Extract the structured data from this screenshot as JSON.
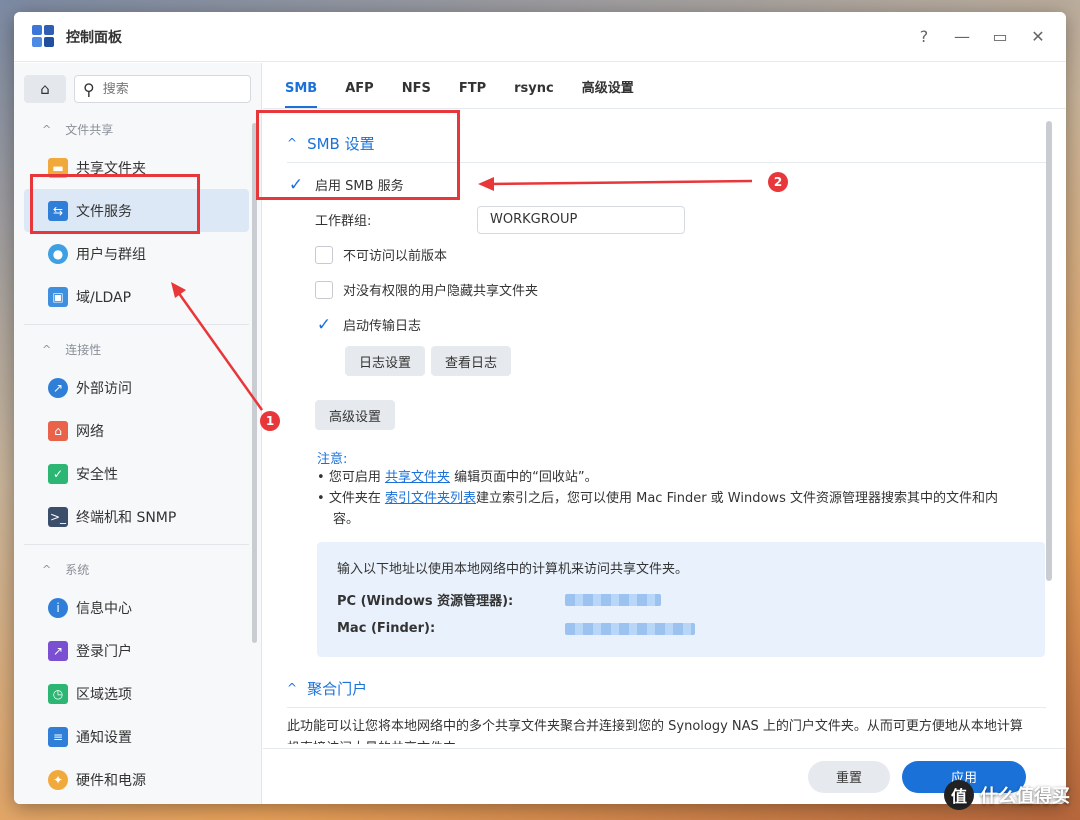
{
  "window": {
    "title": "控制面板",
    "controls": [
      "?",
      "—",
      "▭",
      "✕"
    ]
  },
  "sidebar": {
    "search_placeholder": "搜索",
    "groups": [
      {
        "title": "文件共享",
        "items": [
          {
            "label": "共享文件夹",
            "icon": "folder-icon",
            "color": "#f2a93b"
          },
          {
            "label": "文件服务",
            "icon": "file-services-icon",
            "color": "#2f7fd9",
            "active": true
          },
          {
            "label": "用户与群组",
            "icon": "users-icon",
            "color": "#3e9fe2"
          },
          {
            "label": "域/LDAP",
            "icon": "ldap-icon",
            "color": "#3e8fe0"
          }
        ]
      },
      {
        "title": "连接性",
        "items": [
          {
            "label": "外部访问",
            "icon": "external-access-icon",
            "color": "#2f7fd9"
          },
          {
            "label": "网络",
            "icon": "network-icon",
            "color": "#e8634a"
          },
          {
            "label": "安全性",
            "icon": "security-icon",
            "color": "#2bb673"
          },
          {
            "label": "终端机和 SNMP",
            "icon": "terminal-icon",
            "color": "#3b4f6b"
          }
        ]
      },
      {
        "title": "系统",
        "items": [
          {
            "label": "信息中心",
            "icon": "info-icon",
            "color": "#2f7fd9"
          },
          {
            "label": "登录门户",
            "icon": "login-portal-icon",
            "color": "#7b4fd1"
          },
          {
            "label": "区域选项",
            "icon": "regional-icon",
            "color": "#2bb673"
          },
          {
            "label": "通知设置",
            "icon": "notification-icon",
            "color": "#2f7fd9"
          },
          {
            "label": "硬件和电源",
            "icon": "power-icon",
            "color": "#f2a93b"
          }
        ]
      }
    ]
  },
  "tabs": [
    "SMB",
    "AFP",
    "NFS",
    "FTP",
    "rsync",
    "高级设置"
  ],
  "smb": {
    "section_title": "SMB 设置",
    "enable_label": "启用 SMB 服务",
    "workgroup_label": "工作群组:",
    "workgroup_value": "WORKGROUP",
    "opt1": "不可访问以前版本",
    "opt2": "对没有权限的用户隐藏共享文件夹",
    "opt3": "启动传输日志",
    "log_settings": "日志设置",
    "view_log": "查看日志",
    "advanced": "高级设置",
    "note_title": "注意:",
    "note1_pre": "您可启用 ",
    "note1_link": "共享文件夹",
    "note1_post": " 编辑页面中的“回收站”。",
    "note2_pre": "文件夹在 ",
    "note2_link": "索引文件夹列表",
    "note2_post": "建立索引之后，您可以使用 Mac Finder 或 Windows 文件资源管理器搜索其中的文件和内",
    "note2_tail": "容。",
    "info_intro": "输入以下地址以使用本地网络中的计算机来访问共享文件夹。",
    "pc_label": "PC (Windows 资源管理器):",
    "mac_label": "Mac (Finder):"
  },
  "portal": {
    "section_title": "聚合门户",
    "para": "此功能可以让您将本地网络中的多个共享文件夹聚合并连接到您的 Synology NAS 上的门户文件夹。从而可更方便地从本地计算机直接访问大量的共享文件夹。"
  },
  "footer": {
    "reset": "重置",
    "apply": "应用"
  },
  "annotations": {
    "badge1": "1",
    "badge2": "2"
  },
  "watermark": {
    "logo": "值",
    "text": "什么值得买"
  }
}
